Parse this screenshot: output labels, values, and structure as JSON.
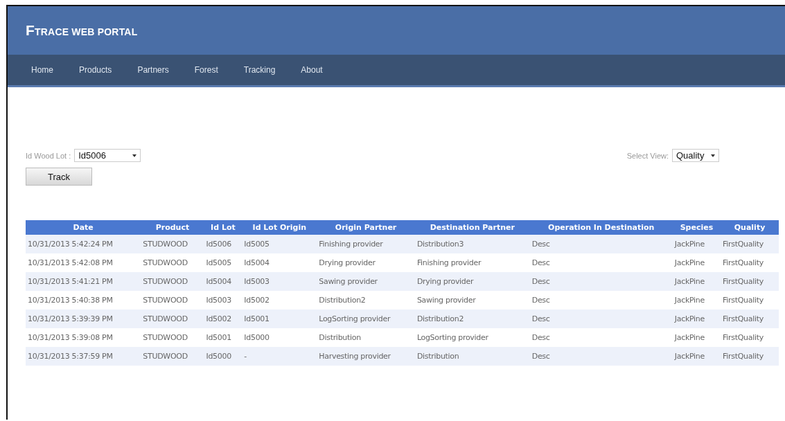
{
  "header": {
    "title": "FTRACE WEB PORTAL"
  },
  "nav": [
    {
      "label": "Home"
    },
    {
      "label": "Products"
    },
    {
      "label": "Partners"
    },
    {
      "label": "Forest"
    },
    {
      "label": "Tracking"
    },
    {
      "label": "About"
    }
  ],
  "lot_filter": {
    "label": "Id Wood Lot :",
    "value": "Id5006"
  },
  "track_button": "Track",
  "view_filter": {
    "label": "Select View:",
    "value": "Quality"
  },
  "table": {
    "columns": [
      "Date",
      "Product",
      "Id Lot",
      "Id Lot Origin",
      "Origin Partner",
      "Destination Partner",
      "Operation In Destination",
      "Species",
      "Quality"
    ],
    "rows": [
      [
        "10/31/2013 5:42:24 PM",
        "STUDWOOD",
        "Id5006",
        "Id5005",
        "Finishing provider",
        "Distribution3",
        "Desc",
        "JackPine",
        "FirstQuality"
      ],
      [
        "10/31/2013 5:42:08 PM",
        "STUDWOOD",
        "Id5005",
        "Id5004",
        "Drying provider",
        "Finishing provider",
        "Desc",
        "JackPine",
        "FirstQuality"
      ],
      [
        "10/31/2013 5:41:21 PM",
        "STUDWOOD",
        "Id5004",
        "Id5003",
        "Sawing provider",
        "Drying provider",
        "Desc",
        "JackPine",
        "FirstQuality"
      ],
      [
        "10/31/2013 5:40:38 PM",
        "STUDWOOD",
        "Id5003",
        "Id5002",
        "Distribution2",
        "Sawing provider",
        "Desc",
        "JackPine",
        "FirstQuality"
      ],
      [
        "10/31/2013 5:39:39 PM",
        "STUDWOOD",
        "Id5002",
        "Id5001",
        "LogSorting provider",
        "Distribution2",
        "Desc",
        "JackPine",
        "FirstQuality"
      ],
      [
        "10/31/2013 5:39:08 PM",
        "STUDWOOD",
        "Id5001",
        "Id5000",
        "Distribution",
        "LogSorting provider",
        "Desc",
        "JackPine",
        "FirstQuality"
      ],
      [
        "10/31/2013 5:37:59 PM",
        "STUDWOOD",
        "Id5000",
        "-",
        "Harvesting provider",
        "Distribution",
        "Desc",
        "JackPine",
        "FirstQuality"
      ]
    ]
  }
}
